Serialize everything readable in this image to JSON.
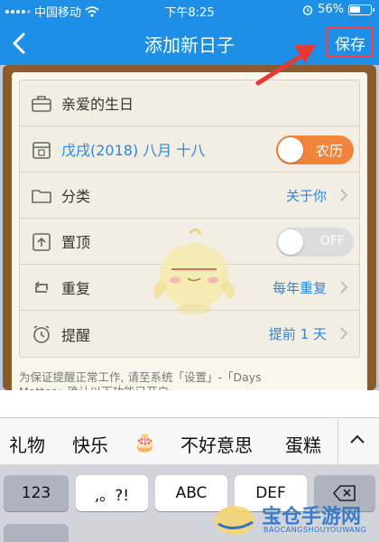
{
  "status_bar": {
    "carrier": "中国移动",
    "time": "下午8:25",
    "battery": "56%",
    "battery_level": 0.56
  },
  "nav": {
    "title": "添加新日子",
    "save_label": "保存"
  },
  "form": {
    "name": "亲爱的生日",
    "date": "戊戌(2018) 八月 十八",
    "lunar_toggle": {
      "label": "农历",
      "state": "on"
    },
    "category": {
      "label": "分类",
      "value": "关于你"
    },
    "pin_top": {
      "label": "置顶",
      "toggle_label": "OFF",
      "state": "off"
    },
    "repeat": {
      "label": "重复",
      "value": "每年重复"
    },
    "reminder": {
      "label": "提醒",
      "value": "提前 1 天"
    }
  },
  "notice": {
    "line1": "为保证提醒正常工作, 请至系统「设置」-「Days",
    "line2": "Matter」确认以下功能已开启:"
  },
  "keyboard": {
    "suggestions": [
      "礼物",
      "快乐",
      "🎂",
      "不好意思",
      "蛋糕"
    ],
    "keys": [
      "123",
      ",。?!",
      "ABC",
      "DEF"
    ]
  },
  "watermark": {
    "text": "宝仓手游网",
    "sub": "BAOCANGSHOUYOUWANG"
  },
  "colors": {
    "accent": "#1d8fe7",
    "highlight": "#ff3b3b",
    "toggle_on": "#f0843a",
    "date_text": "#2a86e0"
  }
}
